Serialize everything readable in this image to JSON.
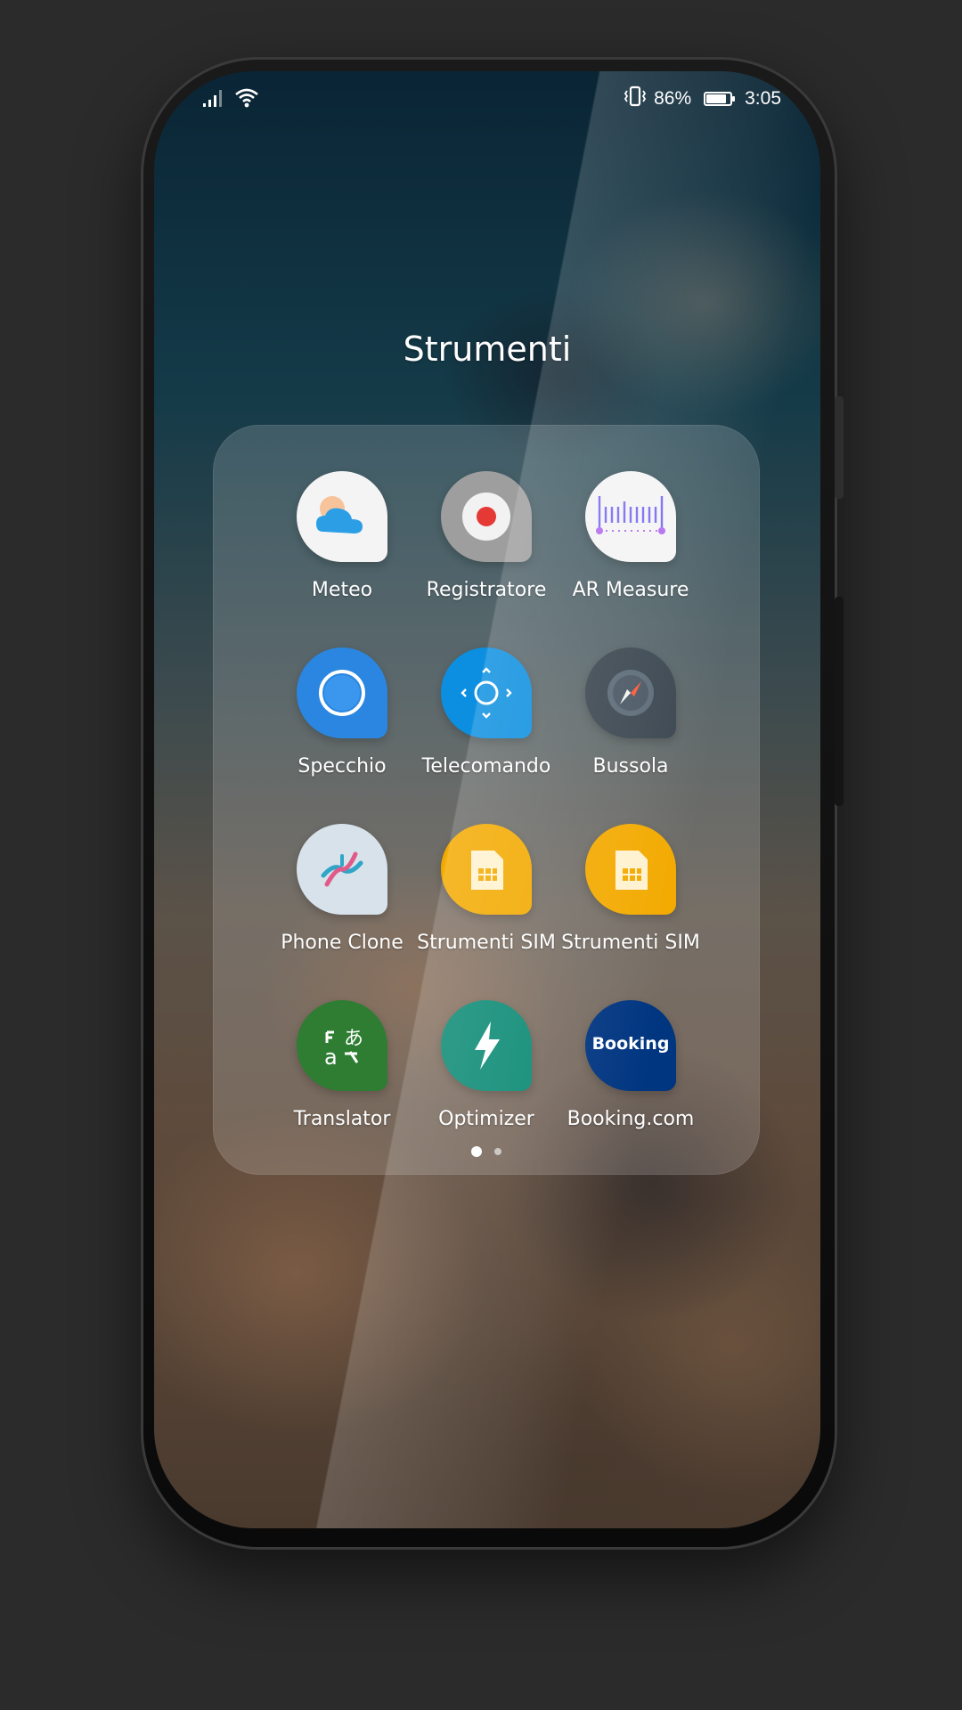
{
  "status_bar": {
    "battery_percent": "86%",
    "battery_level": 0.86,
    "time": "3:05",
    "icons": [
      "signal-icon",
      "wifi-icon",
      "vibrate-icon",
      "battery-icon"
    ]
  },
  "folder": {
    "title": "Strumenti",
    "current_page": 1,
    "page_count": 2,
    "apps": [
      {
        "label": "Meteo",
        "icon": "weather-icon",
        "color": "#f4f4f4"
      },
      {
        "label": "Registratore",
        "icon": "recorder-icon",
        "color": "#9e9e9e"
      },
      {
        "label": "AR Measure",
        "icon": "ar-measure-icon",
        "color": "#f4f4f4"
      },
      {
        "label": "Specchio",
        "icon": "mirror-icon",
        "color": "#2a86e0"
      },
      {
        "label": "Telecomando",
        "icon": "remote-control-icon",
        "color": "#0c8fe0"
      },
      {
        "label": "Bussola",
        "icon": "compass-icon",
        "color": "#3b4650"
      },
      {
        "label": "Phone Clone",
        "icon": "phone-clone-icon",
        "color": "#d8e2ea"
      },
      {
        "label": "Strumenti SIM",
        "icon": "sim-card-icon",
        "color": "#f3aa00"
      },
      {
        "label": "Strumenti SIM",
        "icon": "sim-card-icon",
        "color": "#f3aa00"
      },
      {
        "label": "Translator",
        "icon": "translator-icon",
        "color": "#2e7d32"
      },
      {
        "label": "Optimizer",
        "icon": "optimizer-icon",
        "color": "#0b8a74"
      },
      {
        "label": "Booking.com",
        "icon": "booking-icon",
        "color": "#003580",
        "icon_text": "Booking"
      }
    ]
  }
}
